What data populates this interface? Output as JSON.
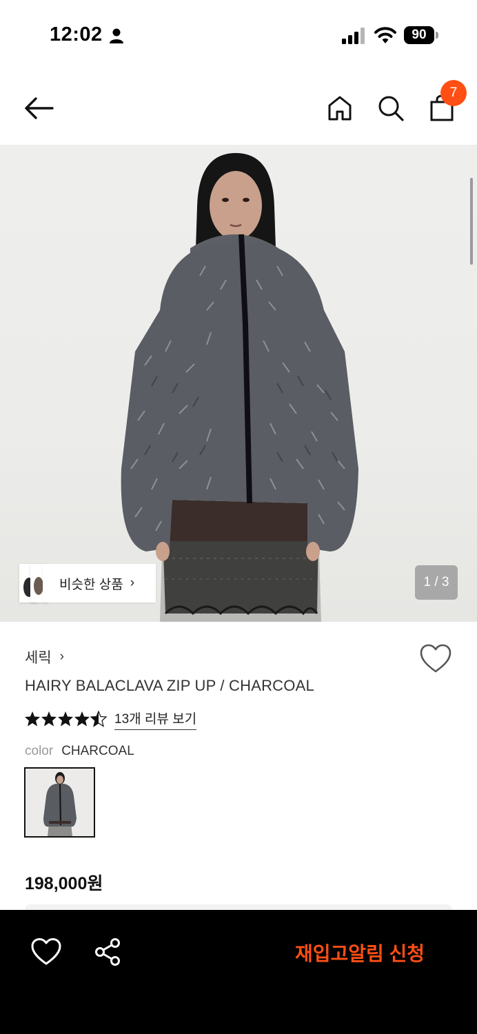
{
  "status_bar": {
    "time": "12:02",
    "battery": "90",
    "icons": [
      "person-icon",
      "cellular-signal-icon",
      "wifi-icon",
      "battery-icon"
    ]
  },
  "nav": {
    "icons": [
      "back-arrow-icon",
      "home-icon",
      "search-icon",
      "shopping-bag-icon"
    ],
    "cart_count": "7"
  },
  "gallery": {
    "similar_label": "비슷한 상품",
    "similar_chevron": "›",
    "page_counter": "1 / 3"
  },
  "product": {
    "brand": "세릭",
    "brand_chevron": "›",
    "name": "HAIRY BALACLAVA ZIP UP / CHARCOAL",
    "rating": 4.5,
    "rating_max": 5,
    "review_link": "13개 리뷰 보기",
    "color_label": "color",
    "color_value": "CHARCOAL",
    "price": "198,000원"
  },
  "bottom_bar": {
    "restock_label": "재입고알림 신청",
    "icons": [
      "heart-icon",
      "share-icon"
    ]
  },
  "colors": {
    "accent": "#ff4f14",
    "bottom_bar_bg": "#000000",
    "counter_bg": "#a8a8a8"
  }
}
